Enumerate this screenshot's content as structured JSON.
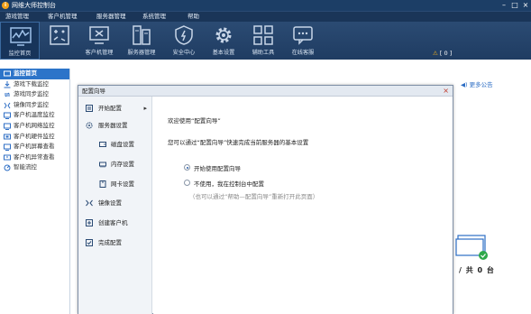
{
  "window": {
    "title": "网维大师控制台",
    "logo": "i"
  },
  "menubar": [
    "游戏管理",
    "客户机管理",
    "服务器管理",
    "系统管理",
    "帮助"
  ],
  "toolbar": {
    "tools": [
      {
        "label": "监控首页",
        "icon": "monitor-chart-icon",
        "active": true
      },
      {
        "label": "",
        "icon": "game-pad-icon"
      },
      {
        "label": "客户机管理",
        "icon": "client-pc-icon"
      },
      {
        "label": "服务器管理",
        "icon": "server-icon"
      },
      {
        "label": "安全中心",
        "icon": "shield-icon"
      },
      {
        "label": "基本设置",
        "icon": "gear-icon"
      },
      {
        "label": "辅助工具",
        "icon": "grid-icon"
      },
      {
        "label": "在线客服",
        "icon": "chat-icon"
      }
    ],
    "alert": {
      "icon": "warning-icon",
      "text": "[ 0 ]"
    }
  },
  "sidebar": {
    "items": [
      {
        "label": "监控首页",
        "icon": "home-icon",
        "active": true
      },
      {
        "label": "游戏下载监控",
        "icon": "download-icon"
      },
      {
        "label": "游戏同步监控",
        "icon": "sync-icon"
      },
      {
        "label": "镜像同步监控",
        "icon": "image-sync-icon"
      },
      {
        "label": "客户机温度监控",
        "icon": "temperature-icon"
      },
      {
        "label": "客户机网络监控",
        "icon": "network-icon"
      },
      {
        "label": "客户机硬件监控",
        "icon": "hardware-icon"
      },
      {
        "label": "客户机屏幕查看",
        "icon": "screen-icon"
      },
      {
        "label": "客户机异常查看",
        "icon": "error-icon"
      },
      {
        "label": "智能流控",
        "icon": "flow-control-icon"
      }
    ]
  },
  "main": {
    "announcement": "更多公告",
    "count_text": "/ 共 0 台"
  },
  "dialog": {
    "title": "配置向导",
    "close": "×",
    "nav": [
      {
        "label": "开始配置",
        "icon": "start-config-icon",
        "arrow": "▸"
      },
      {
        "label": "服务器设置",
        "icon": "server-settings-icon"
      },
      {
        "label": "磁盘设置",
        "icon": "disk-icon"
      },
      {
        "label": "内存设置",
        "icon": "memory-icon"
      },
      {
        "label": "网卡设置",
        "icon": "nic-icon"
      },
      {
        "label": "镜像设置",
        "icon": "mirror-icon"
      },
      {
        "label": "创建客户机",
        "icon": "create-client-icon"
      },
      {
        "label": "完成配置",
        "icon": "finish-config-icon"
      }
    ],
    "welcome": "欢迎使用“配置向导”",
    "desc": "您可以通过“配置向导”快速完成当前服务器的基本设置",
    "options": [
      {
        "label": "开始使用配置向导",
        "selected": true
      },
      {
        "label": "不使用，我在控制台中配置",
        "selected": false
      }
    ],
    "hint": "（也可以通过“帮助—配置向导”重新打开此页面）"
  }
}
